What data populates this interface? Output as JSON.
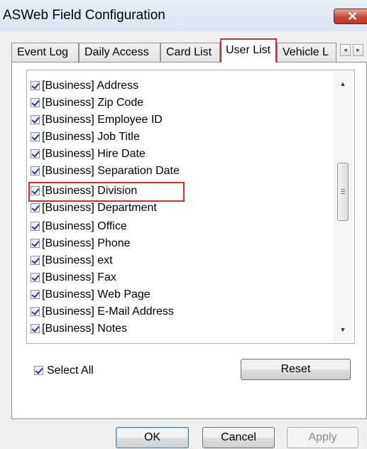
{
  "window": {
    "title": "ASWeb Field Configuration",
    "close_glyph": "✕"
  },
  "tabs": [
    {
      "label": "Event Log"
    },
    {
      "label": "Daily Access"
    },
    {
      "label": "Card List"
    },
    {
      "label": "User List",
      "active": true
    },
    {
      "label": "Vehicle L"
    }
  ],
  "tab_scroll": {
    "left_glyph": "◂",
    "right_glyph": "▸"
  },
  "fields": [
    {
      "label": "[Business] Address",
      "checked": true
    },
    {
      "label": "[Business] Zip Code",
      "checked": true
    },
    {
      "label": "[Business] Employee ID",
      "checked": true
    },
    {
      "label": "[Business] Job Title",
      "checked": true
    },
    {
      "label": "[Business] Hire Date",
      "checked": true
    },
    {
      "label": "[Business] Separation Date",
      "checked": true
    },
    {
      "label": "[Business] Division",
      "checked": true
    },
    {
      "label": "[Business] Department",
      "checked": true
    },
    {
      "label": "[Business] Office",
      "checked": true
    },
    {
      "label": "[Business] Phone",
      "checked": true
    },
    {
      "label": "[Business] ext",
      "checked": true
    },
    {
      "label": "[Business] Fax",
      "checked": true
    },
    {
      "label": "[Business] Web Page",
      "checked": true
    },
    {
      "label": "[Business] E-Mail Address",
      "checked": true
    },
    {
      "label": "[Business] Notes",
      "checked": true
    }
  ],
  "scrollbar": {
    "up_glyph": "▲",
    "down_glyph": "▼"
  },
  "select_all": {
    "label": "Select All",
    "checked": true
  },
  "buttons": {
    "reset": "Reset",
    "ok": "OK",
    "cancel": "Cancel",
    "apply": "Apply"
  },
  "colors": {
    "highlight": "#cc2f2f",
    "close": "#c94a34"
  }
}
